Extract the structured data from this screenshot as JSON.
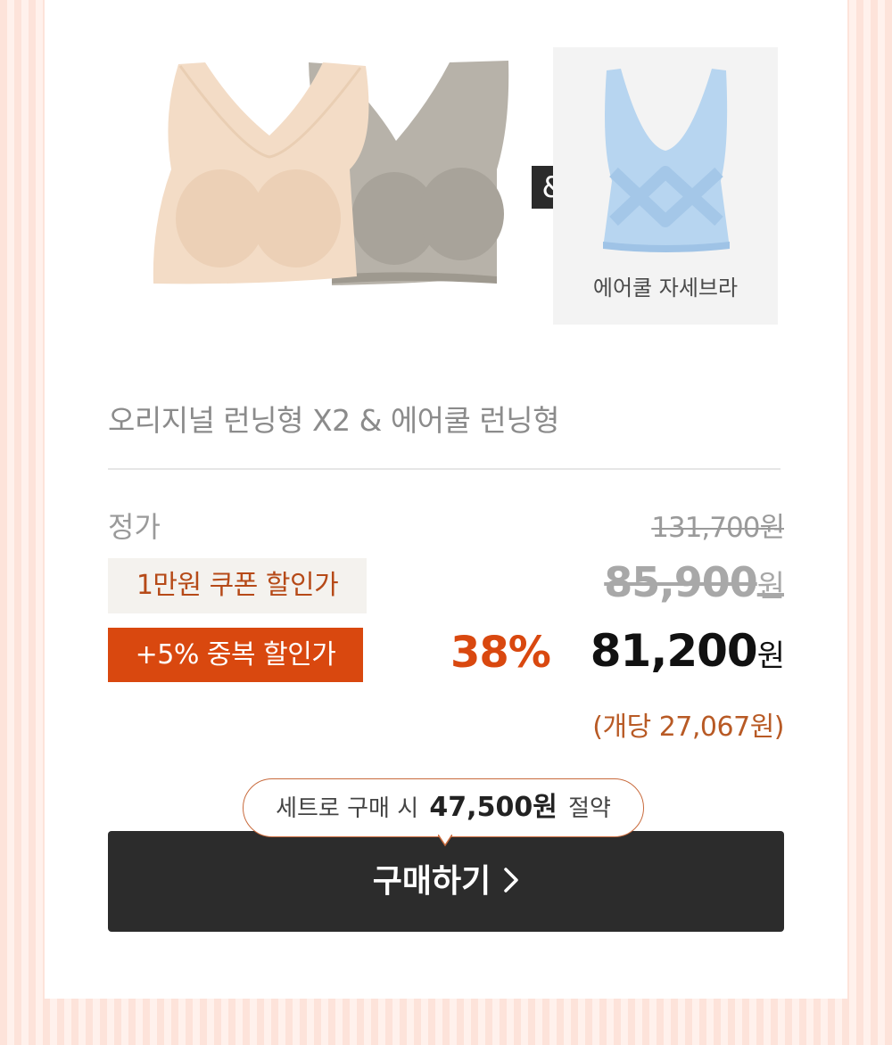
{
  "addon_label": "에어쿨 자세브라",
  "amp_symbol": "&",
  "set_name": "오리지널 런닝형 X2 & 에어쿨 런닝형",
  "pricing": {
    "regular_label": "정가",
    "regular_price": "131,700",
    "coupon_label": "1만원 쿠폰 할인가",
    "coupon_price": "85,900",
    "extra_label": "+5% 중복 할인가",
    "discount_rate": "38%",
    "final_price": "81,200",
    "currency_unit": "원",
    "per_unit": "(개당 27,067원)"
  },
  "savings": {
    "prefix": "세트로 구매 시",
    "amount": "47,500원",
    "suffix": "절약"
  },
  "buy_button_label": "구매하기",
  "colors": {
    "accent": "#d9480f",
    "button": "#2c2c2c",
    "nude_bra": "#f3dcc6",
    "gray_bra": "#b7b2a9",
    "blue_bra": "#b7d5f0"
  }
}
